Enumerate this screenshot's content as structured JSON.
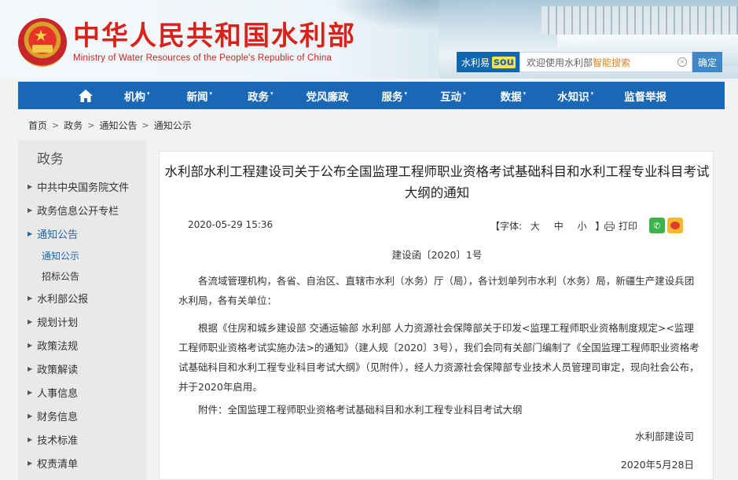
{
  "header": {
    "title": "中华人民共和国水利部",
    "subtitle": "Ministry of Water Resources of the People's Republic of China"
  },
  "search": {
    "brand_label": "水利易",
    "brand_badge": "sou",
    "placeholder_prefix": "欢迎使用水利部",
    "placeholder_highlight": "智能搜索",
    "submit_label": "确定"
  },
  "nav": {
    "items": [
      {
        "label": "机构",
        "has_menu": true
      },
      {
        "label": "新闻",
        "has_menu": true
      },
      {
        "label": "政务",
        "has_menu": true
      },
      {
        "label": "党风廉政",
        "has_menu": false
      },
      {
        "label": "服务",
        "has_menu": true
      },
      {
        "label": "互动",
        "has_menu": true
      },
      {
        "label": "数据",
        "has_menu": true
      },
      {
        "label": "水知识",
        "has_menu": true
      },
      {
        "label": "监督举报",
        "has_menu": false
      }
    ]
  },
  "breadcrumb": [
    "首页",
    "政务",
    "通知公告",
    "通知公示"
  ],
  "sidebar": {
    "heading": "政务",
    "items": [
      {
        "label": "中共中央国务院文件"
      },
      {
        "label": "政务信息公开专栏"
      },
      {
        "label": "通知公告"
      },
      {
        "label": "水利部公报"
      },
      {
        "label": "规划计划"
      },
      {
        "label": "政策法规"
      },
      {
        "label": "政策解读"
      },
      {
        "label": "人事信息"
      },
      {
        "label": "财务信息"
      },
      {
        "label": "技术标准"
      },
      {
        "label": "权责清单"
      }
    ],
    "subitems": [
      {
        "label": "通知公示"
      },
      {
        "label": "招标公告"
      }
    ]
  },
  "article": {
    "title": "水利部水利工程建设司关于公布全国监理工程师职业资格考试基础科目和水利工程专业科目考试大纲的通知",
    "date": "2020-05-29 15:36",
    "font_label": "【字体:",
    "font_large": "大",
    "font_medium": "中",
    "font_small": "小",
    "font_close": "】",
    "print_label": "打印",
    "doc_number": "建设函〔2020〕1号",
    "para1": "各流域管理机构，各省、自治区、直辖市水利（水务）厅（局），各计划单列市水利（水务）局，新疆生产建设兵团水利局，各有关单位：",
    "para2": "根据《住房和城乡建设部 交通运输部 水利部 人力资源社会保障部关于印发<监理工程师职业资格制度规定><监理工程师职业资格考试实施办法>的通知》（建人规〔2020〕3号），我们会同有关部门编制了《全国监理工程师职业资格考试基础科目和水利工程专业科目考试大纲》（见附件），经人力资源社会保障部专业技术人员管理司审定，现向社会公布，并于2020年启用。",
    "attachment": "附件：全国监理工程师职业资格考试基础科目和水利工程专业科目考试大纲",
    "signer": "水利部建设司",
    "sign_date": "2020年5月28日"
  },
  "colors": {
    "nav_bg": "#1a67b5",
    "title_red": "#d8231b",
    "link_blue": "#1a67b5"
  }
}
